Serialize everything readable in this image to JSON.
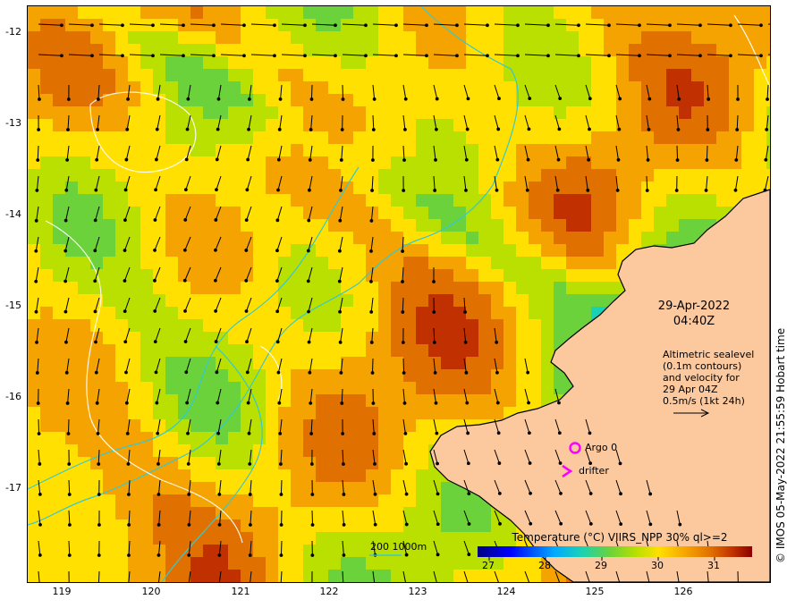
{
  "title": {
    "date": "29-Apr-2022",
    "time": "04:40Z"
  },
  "axes": {
    "x_ticks": [
      "119",
      "120",
      "121",
      "122",
      "123",
      "124",
      "125",
      "126"
    ],
    "y_ticks": [
      "-12",
      "-13",
      "-14",
      "-15",
      "-16",
      "-17"
    ],
    "x_range": [
      118.6,
      126.9
    ],
    "y_range": [
      -17.97,
      -11.7
    ]
  },
  "legend": {
    "altimetry_lines": [
      "Altimetric sealevel",
      "(0.1m contours)",
      "and velocity for",
      "29 Apr 04Z",
      "0.5m/s (1kt 24h)"
    ],
    "argo_label": "Argo 0",
    "drifter_label": "drifter",
    "depth_contours_label": "200  1000m"
  },
  "colorbar": {
    "title": "Temperature (°C) VIIRS_NPP 30% ql>=2",
    "ticks": [
      "27",
      "28",
      "29",
      "30",
      "31"
    ],
    "range": [
      26.8,
      31.7
    ]
  },
  "copyright": "© IMOS 05-May-2022 21:55:59 Hobart time",
  "colors": {
    "land": "#fcc99f",
    "coast": "#000000",
    "bathymetry": "#36c9d0",
    "sealevel_contours": "#ffffff",
    "argo_marker": "#ff00ff",
    "drifter_marker": "#ff00ff",
    "vectors": "#000000"
  }
}
